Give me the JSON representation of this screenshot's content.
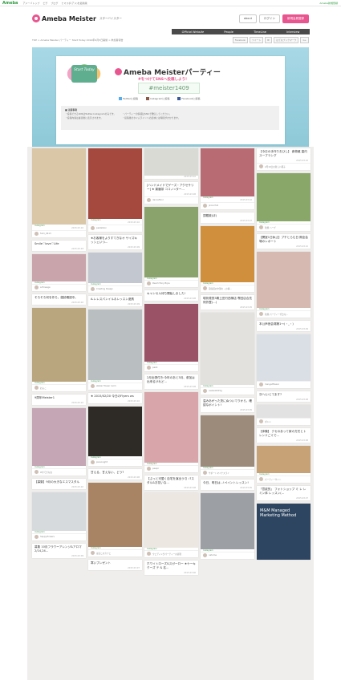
{
  "topbar": {
    "brand": "Ameba",
    "links": [
      "アメーバトップ",
      "ピグ",
      "ブログ",
      "ヒマスポ(アメ)を最新版"
    ],
    "right": "Ameba新規登録"
  },
  "header": {
    "logo": "Ameba Meister",
    "tagline": "スターバイスター",
    "buttons": [
      "about",
      "ログイン",
      "新規会員登録"
    ]
  },
  "nav": {
    "items": [
      "Official Website",
      "People",
      "TimeLine",
      "Interview"
    ]
  },
  "subbar": {
    "breadcrumb": "TOP > Ameba Meister パーティー Start Today 2014年9月5日開催 > 参加者報告",
    "share": [
      "Facebook",
      "ツイート",
      "B!",
      "はてなブックマーク",
      "G+"
    ]
  },
  "hero": {
    "badge": "Start Today",
    "title": "Ameba Meisterパーティー",
    "subtitle": "#をつけてSNSへ投稿しよう!",
    "hashtag": "#meister1409",
    "sns": [
      "Twitterに投稿",
      "Instagramに投稿",
      "Facebookに投稿"
    ],
    "notes_heading": "■ 注意事項",
    "notes_left": [
      "・投稿できるSNSはTwitter,Instagramのみです。",
      "・投稿内容は審査後に表示されます。"
    ],
    "notes_right": [
      "・パーティーの情報はSNSで発信してください。",
      "・投稿後のタイムラインへの反映には時間がかかります。"
    ]
  },
  "columns": [
    [
      {
        "color": "#d9c7a8",
        "h": 95,
        "text": "",
        "date": "2015.03.10",
        "user": "fumi_0413",
        "src": "Instagram"
      },
      {
        "color": "#d8d1cc",
        "h": 0,
        "text": "Smile♡love♡Life",
        "date": "2015.03.03",
        "user": "",
        "src": ""
      },
      {
        "color": "#c9a5ab",
        "h": 34,
        "text": "",
        "date": "",
        "user": "a.flowage",
        "src": "Instagram"
      },
      {
        "color": "#d4c3a0",
        "h": 0,
        "text": "そろそろ何を作ろ。雑誌確認中。",
        "date": "2015.03.02",
        "user": "",
        "src": ""
      },
      {
        "color": "#b9a57e",
        "h": 92,
        "text": "",
        "date": "",
        "user": "およこ",
        "src": "Instagram"
      },
      {
        "color": "#ffffff",
        "h": 0,
        "text": "9周年Meister1",
        "date": "2015.03.10",
        "user": "",
        "src": ""
      },
      {
        "color": "#c4a6b4",
        "h": 72,
        "text": "",
        "date": "",
        "user": "#すてきなお",
        "src": "Instagram"
      },
      {
        "color": "#fff",
        "h": 0,
        "text": "【募集】9月の大きなエスマスタル",
        "date": "2015.03.10",
        "user": "",
        "src": ""
      },
      {
        "color": "#d6dadc",
        "h": 48,
        "text": "",
        "date": "",
        "user": "happy.flowers",
        "src": "Instagram"
      },
      {
        "color": "#fff",
        "h": 0,
        "text": "募集 10月フラワーアレンジ&アロマ 2/14,24...",
        "date": "2015.03.09",
        "user": "",
        "src": ""
      }
    ],
    [
      {
        "color": "#a5483e",
        "h": 88,
        "text": "",
        "date": "2015.03.10",
        "user": "pastelbox",
        "src": "Instagram"
      },
      {
        "color": "#fff",
        "h": 0,
        "text": "★お客様をよりすてきなオ  サイズキッシェいつ...",
        "date": "2015.03.09",
        "user": "",
        "src": ""
      },
      {
        "color": "#c3c7cf",
        "h": 38,
        "text": "",
        "date": "",
        "user": "Creating Design",
        "src": "Instagram"
      },
      {
        "color": "#fff",
        "h": 0,
        "text": "A.レレスパンイル＆レッスン遊具",
        "date": "2015.03.09",
        "user": "",
        "src": ""
      },
      {
        "color": "#b9bec0",
        "h": 88,
        "text": "",
        "date": "",
        "user": "atelier flower room",
        "src": "Instagram"
      },
      {
        "color": "#fff",
        "h": 0,
        "text": "★ 2015/02/20 今日のFlyers ws",
        "date": "2015.03.10",
        "user": "",
        "src": ""
      },
      {
        "color": "#2e2a26",
        "h": 62,
        "text": "",
        "date": "",
        "user": "pianonight",
        "src": "Instagram"
      },
      {
        "color": "#fff",
        "h": 0,
        "text": "甘える、甘えない、どう?",
        "date": "2015.03.08",
        "user": "",
        "src": ""
      },
      {
        "color": "#a88465",
        "h": 80,
        "text": "",
        "date": "",
        "user": "ぱぱこのカフェ",
        "src": "Instagram"
      },
      {
        "color": "#fff",
        "h": 0,
        "text": "寒いプレゼント",
        "date": "2015.03.07",
        "user": "",
        "src": ""
      }
    ],
    [
      {
        "color": "#d8dad3",
        "h": 34,
        "text": "",
        "date": "2015.03.10",
        "user": "",
        "src": ""
      },
      {
        "color": "#fff",
        "h": 0,
        "text": "[ハンドメイドでゲーズ・アクセサリー] ★ 薬膳茶 ココノ=ター...",
        "date": "2015.03.08",
        "user": "dancefloor",
        "src": ""
      },
      {
        "color": "#8aa26c",
        "h": 88,
        "text": "",
        "date": "",
        "user": "Peach Fairy Bijou",
        "src": "Instagram"
      },
      {
        "color": "#fff",
        "h": 0,
        "text": "キャンセル待ち開始しました!",
        "date": "2015.03.08",
        "user": "",
        "src": ""
      },
      {
        "color": "#9a5266",
        "h": 72,
        "text": "",
        "date": "",
        "user": "pasti",
        "src": "Instagram"
      },
      {
        "color": "#fff",
        "h": 0,
        "text": "2月出張付き:今年のあと3月、参加は出来るけれど...",
        "date": "2015.03.08",
        "user": "",
        "src": ""
      },
      {
        "color": "#d8a6aa",
        "h": 88,
        "text": "",
        "date": "",
        "user": "pewpr",
        "src": "Instagram"
      },
      {
        "color": "#fff",
        "h": 0,
        "text": "【ぶっと可愛く自宅を演出う!】バスタル&お花いな...",
        "date": "2015.03.08",
        "user": "",
        "src": ""
      },
      {
        "color": "#ece8e1",
        "h": 68,
        "text": "",
        "date": "",
        "user": "ウェディングパーティーの表現",
        "src": "Instagram"
      },
      {
        "color": "#fff",
        "h": 0,
        "text": "ホワイトローズ&スガーロー  ★ケーキクーズ テ & 名...",
        "date": "2015.03.06",
        "user": "",
        "src": ""
      }
    ],
    [
      {
        "color": "#b96b74",
        "h": 60,
        "text": "",
        "date": "2015.03.10",
        "user": "jiroorchid",
        "src": "Instagram"
      },
      {
        "color": "#fff",
        "h": 0,
        "text": "頂戴致(ほ)",
        "date": "2015.03.07",
        "user": "",
        "src": ""
      },
      {
        "color": "#cf8f3c",
        "h": 70,
        "text": "",
        "date": "",
        "user": "花咲道の中部の ~の事...",
        "src": "Instagram"
      },
      {
        "color": "#fff",
        "h": 0,
        "text": "現状発覚3期土田行西様店 専団店合充例外歴(...)",
        "date": "2015.03.05",
        "user": "",
        "src": ""
      },
      {
        "color": "#e3e1de",
        "h": 90,
        "text": "",
        "date": "",
        "user": "ceatsii2015g",
        "src": "Instagram"
      },
      {
        "color": "#fff",
        "h": 0,
        "text": "温みあがった茨にぬついてりから、確認なポイント!",
        "date": "2015.03.05",
        "user": "",
        "src": ""
      },
      {
        "color": "#9c8a7a",
        "h": 64,
        "text": "",
        "date": "",
        "user": "サポートマイナスライ",
        "src": "Instagram"
      },
      {
        "color": "#fff",
        "h": 0,
        "text": "今日、明日は…!ペイントレッスン!",
        "date": "2015.03.05",
        "user": "",
        "src": ""
      },
      {
        "color": "#9ca0a5",
        "h": 70,
        "text": "",
        "date": "",
        "user": "natume",
        "src": "Instagram"
      }
    ],
    [
      {
        "color": "#ffffff",
        "h": 0,
        "text": "【今日の手作りおひし】 食物蔵 歯内ス一プラング",
        "date": "2015.03.10",
        "user": "2月10日の新しい様子",
        "src": ""
      },
      {
        "color": "#8aa76a",
        "h": 60,
        "text": "",
        "date": "",
        "user": "新規 ハーブ",
        "src": "Instagram"
      },
      {
        "color": "#fff",
        "h": 0,
        "text": "【開室1日休止】プチとらむ日 期全会場のレポート",
        "date": "2015.03.10",
        "user": "",
        "src": ""
      },
      {
        "color": "#d6b9b0",
        "h": 70,
        "text": "",
        "date": "",
        "user": "新規 パーティー行きな...",
        "src": "Instagram"
      },
      {
        "color": "#fff",
        "h": 0,
        "text": "本公声音会場第1～(・_・)",
        "date": "2015.03.09",
        "user": "",
        "src": ""
      },
      {
        "color": "#dadfe6",
        "h": 58,
        "text": "",
        "date": "",
        "user": "mal.getflower",
        "src": ""
      },
      {
        "color": "#fff",
        "h": 0,
        "text": "次へ/いとてます?",
        "date": "2015.03.08",
        "user": "",
        "src": ""
      },
      {
        "color": "#e2e2e2",
        "h": 16,
        "text": "",
        "date": "",
        "user": "ボンン",
        "src": ""
      },
      {
        "color": "#fff",
        "h": 0,
        "text": "【体験】 クセのあって家の方式とトレンドごミで...",
        "date": "2015.03.08",
        "user": "",
        "src": ""
      },
      {
        "color": "#c7a277",
        "h": 34,
        "text": "",
        "date": "",
        "user": "パーティーサイト",
        "src": "Instagram"
      },
      {
        "color": "#fff",
        "h": 0,
        "text": "「意欲的」 フォトショップ ミ レ レミン体 レッスン(...",
        "date": "2015.03.07",
        "user": "",
        "src": ""
      },
      {
        "color": "#2d4560",
        "h": 70,
        "text": "M&M Managed Marketing Method",
        "date": "",
        "user": "",
        "src": ""
      }
    ]
  ]
}
